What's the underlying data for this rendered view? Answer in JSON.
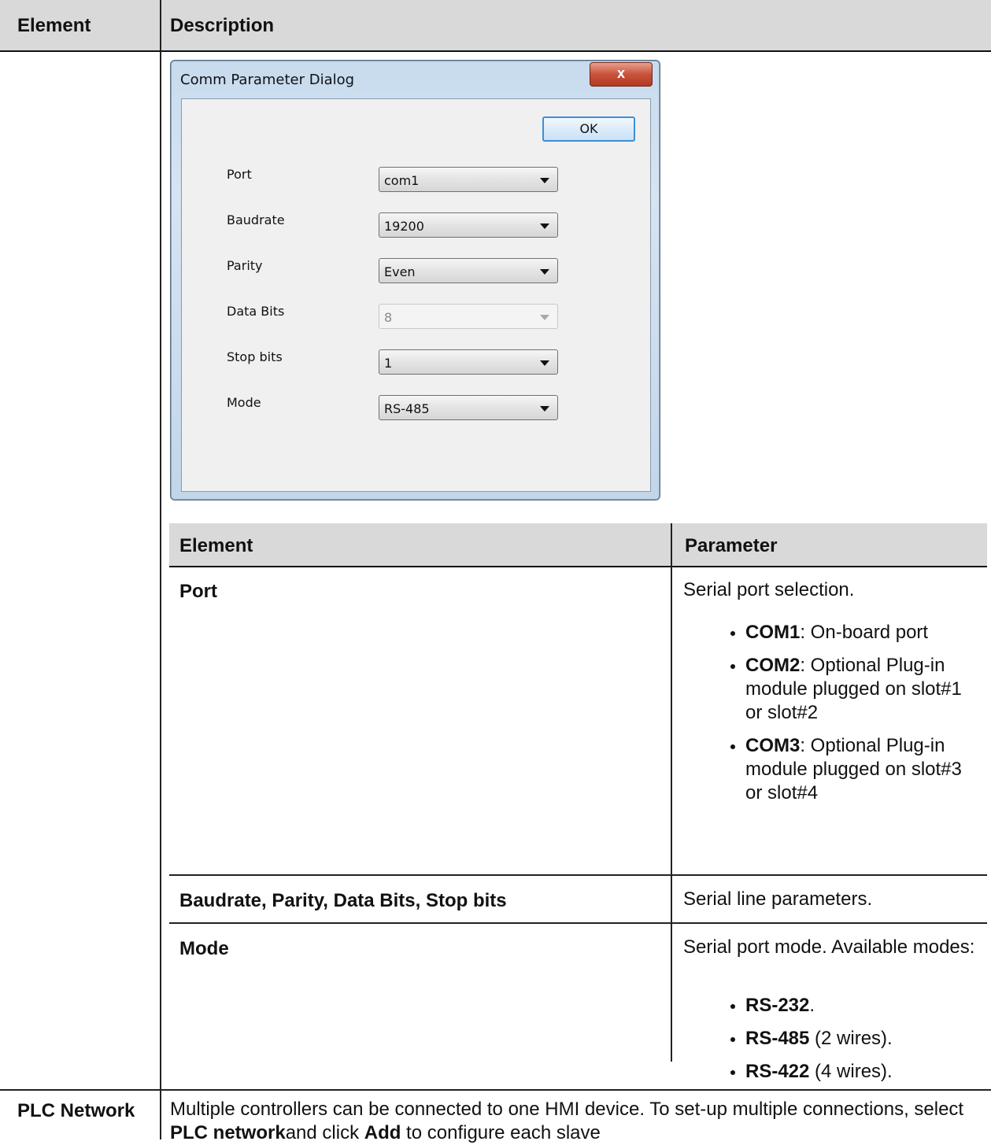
{
  "outer": {
    "header_element": "Element",
    "header_description": "Description"
  },
  "dialog": {
    "title": "Comm Parameter Dialog",
    "close_glyph": "x",
    "ok_label": "OK",
    "fields": [
      {
        "label": "Port",
        "value": "com1",
        "disabled": false
      },
      {
        "label": "Baudrate",
        "value": "19200",
        "disabled": false
      },
      {
        "label": "Parity",
        "value": "Even",
        "disabled": false
      },
      {
        "label": "Data Bits",
        "value": "8",
        "disabled": true
      },
      {
        "label": "Stop bits",
        "value": "1",
        "disabled": false
      },
      {
        "label": "Mode",
        "value": "RS-485",
        "disabled": false
      }
    ]
  },
  "inner": {
    "header_element": "Element",
    "header_parameter": "Parameter",
    "rows": {
      "port": {
        "name": "Port",
        "intro": "Serial port selection.",
        "items": [
          {
            "bold": "COM1",
            "rest": ": On-board port"
          },
          {
            "bold": "COM2",
            "rest": ": Optional Plug-in module plugged on slot#1 or slot#2"
          },
          {
            "bold": "COM3",
            "rest": ": Optional Plug-in module plugged on slot#3 or slot#4"
          }
        ]
      },
      "serial": {
        "name": "Baudrate, Parity, Data Bits, Stop bits",
        "desc": "Serial line parameters."
      },
      "mode": {
        "name": "Mode",
        "intro": "Serial port mode. Available modes:",
        "items": [
          {
            "bold": "RS-232",
            "rest": "."
          },
          {
            "bold": "RS-485",
            "rest": " (2 wires)."
          },
          {
            "bold": "RS-422",
            "rest": " (4 wires)."
          }
        ]
      }
    }
  },
  "plc": {
    "name": "PLC Network",
    "desc_1": "Multiple controllers can be connected to one HMI device. To set-up multiple connections, select ",
    "desc_bold_1": "PLC network",
    "desc_2": "and click ",
    "desc_bold_2": "Add",
    "desc_3": " to configure each slave"
  }
}
